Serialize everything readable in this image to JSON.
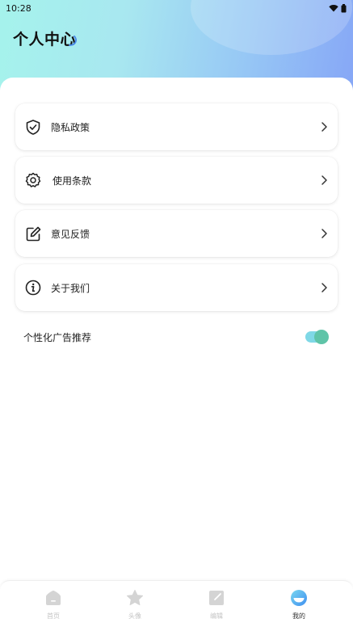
{
  "status_bar": {
    "time": "10:28"
  },
  "header": {
    "title": "个人中心"
  },
  "menu": {
    "items": [
      {
        "label": "隐私政策",
        "icon": "shield-check-icon"
      },
      {
        "label": "使用条款",
        "icon": "gear-icon"
      },
      {
        "label": "意见反馈",
        "icon": "edit-icon"
      },
      {
        "label": "关于我们",
        "icon": "info-icon"
      }
    ]
  },
  "settings": {
    "ads_label": "个性化广告推荐",
    "ads_enabled": true
  },
  "tabbar": {
    "tabs": [
      {
        "label": "首页",
        "icon": "home-icon",
        "active": false
      },
      {
        "label": "头像",
        "icon": "star-icon",
        "active": false
      },
      {
        "label": "编辑",
        "icon": "edit-square-icon",
        "active": false
      },
      {
        "label": "我的",
        "icon": "profile-circle-icon",
        "active": true
      }
    ]
  },
  "colors": {
    "accent": "#5fc4a8",
    "toggle_track": "#7fd8e6",
    "active_tab": "#333333",
    "inactive_tab": "#c4c4c4"
  }
}
